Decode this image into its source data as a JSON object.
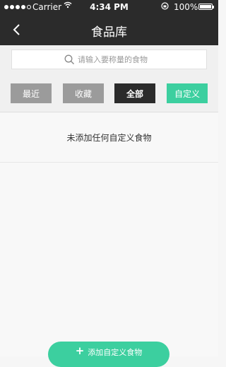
{
  "status_bar": {
    "carrier": "Carrier",
    "time": "4:34 PM",
    "battery": "100%"
  },
  "nav": {
    "title": "食品库"
  },
  "search": {
    "placeholder": "请输入要称量的食物"
  },
  "tabs": [
    {
      "label": "最近"
    },
    {
      "label": "收藏"
    },
    {
      "label": "全部"
    },
    {
      "label": "自定义"
    }
  ],
  "content": {
    "empty_message": "未添加任何自定义食物"
  },
  "add_button": {
    "label": "添加自定义食物"
  },
  "colors": {
    "header_bg": "#2b2b2b",
    "accent_green": "#3ccf9f",
    "tab_gray": "#9b9b9b"
  }
}
